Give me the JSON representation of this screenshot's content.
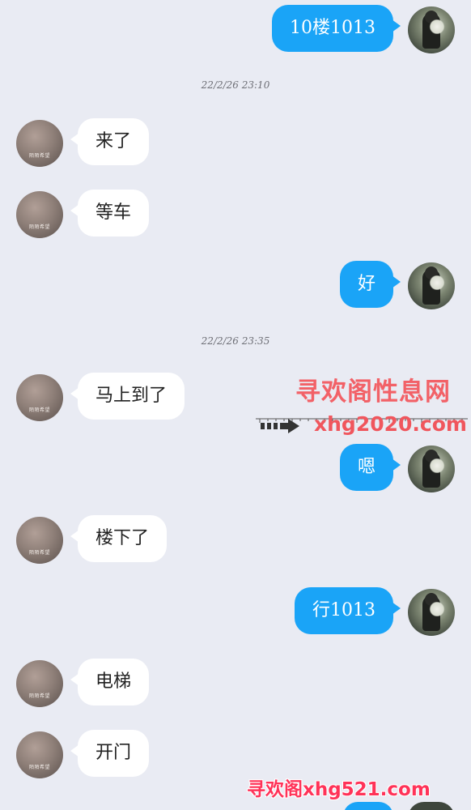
{
  "messages": [
    {
      "dir": "out",
      "text": "10楼1013"
    },
    {
      "dir": "time",
      "text": "22/2/26 23:10"
    },
    {
      "dir": "in",
      "text": "来了"
    },
    {
      "dir": "in",
      "text": "等车"
    },
    {
      "dir": "out",
      "text": "好"
    },
    {
      "dir": "time",
      "text": "22/2/26 23:35"
    },
    {
      "dir": "in",
      "text": "马上到了"
    },
    {
      "dir": "out",
      "text": "嗯"
    },
    {
      "dir": "in",
      "text": "楼下了"
    },
    {
      "dir": "out",
      "text": "行1013"
    },
    {
      "dir": "in",
      "text": "电梯"
    },
    {
      "dir": "in",
      "text": "开门"
    }
  ],
  "avatar_tag": "陌陌希望",
  "watermark": {
    "title": "寻欢阁性息网",
    "url": "xhg2020.com",
    "footer": "寻欢阁xhg521.com"
  },
  "colors": {
    "background": "#e9ebf3",
    "incoming_bubble": "#ffffff",
    "outgoing_bubble": "#1aa4f7",
    "watermark": "#f26167"
  }
}
